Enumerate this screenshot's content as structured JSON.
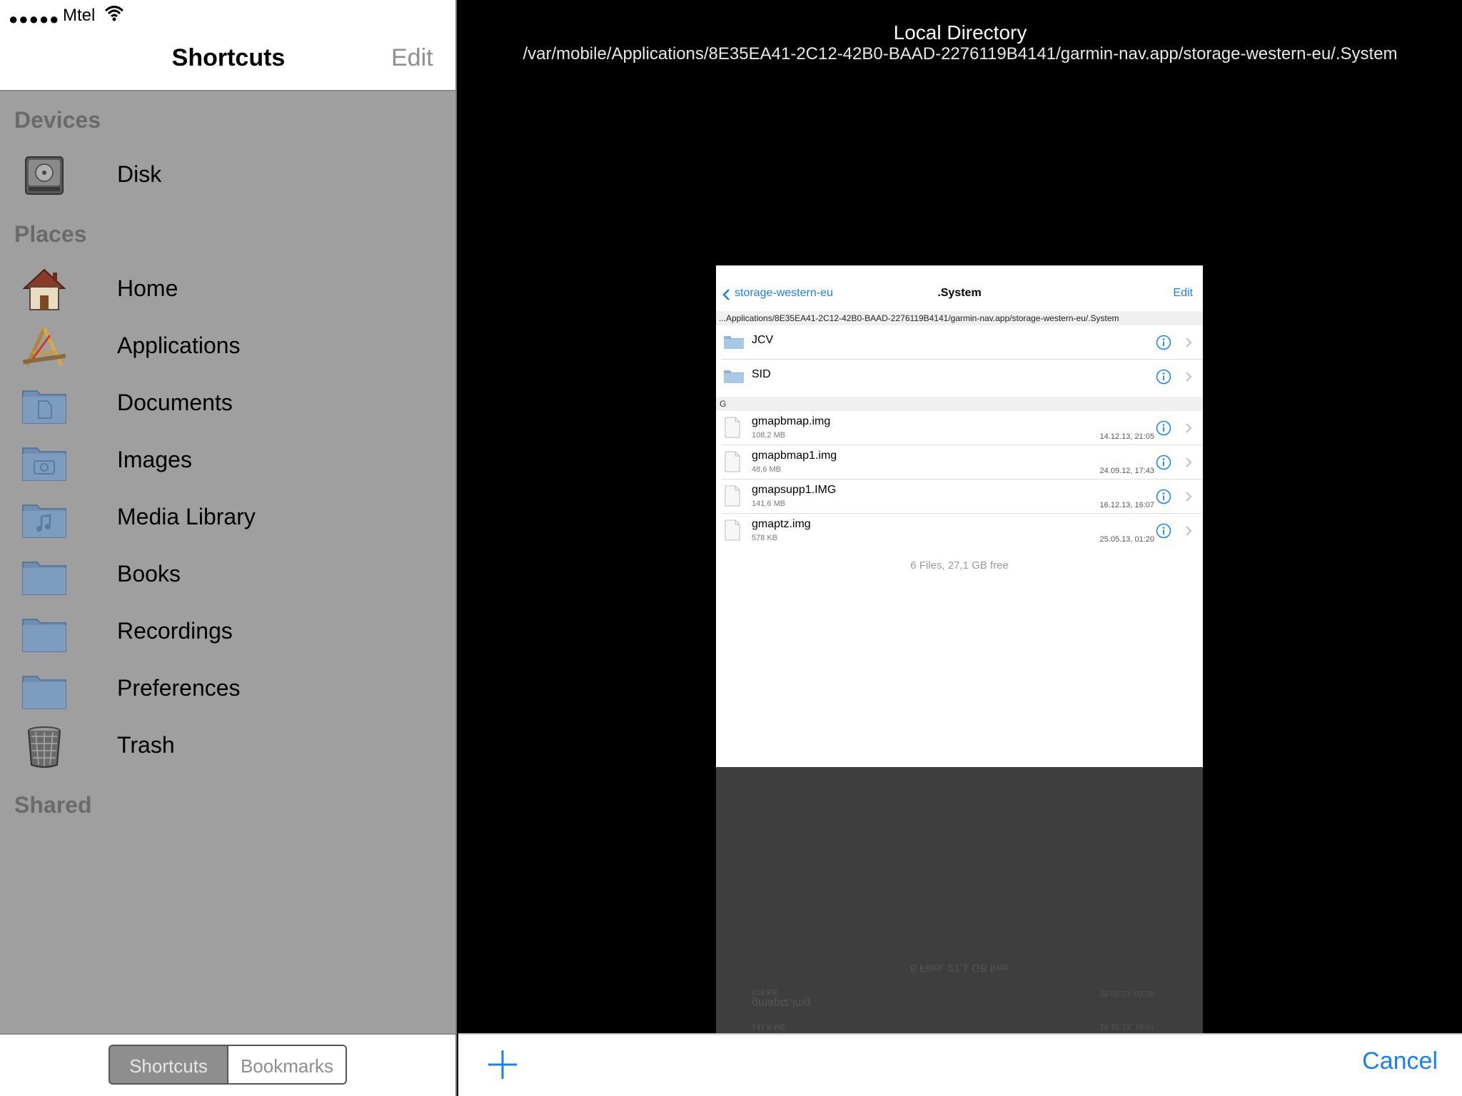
{
  "status_bar": {
    "signal": "●●●●●",
    "carrier": "Mtel"
  },
  "sidebar": {
    "title": "Shortcuts",
    "edit_label": "Edit",
    "sections": {
      "devices": "Devices",
      "places": "Places",
      "shared": "Shared"
    },
    "devices": [
      {
        "label": "Disk",
        "icon": "disk-icon"
      }
    ],
    "places": [
      {
        "label": "Home",
        "icon": "home-icon"
      },
      {
        "label": "Applications",
        "icon": "applications-icon"
      },
      {
        "label": "Documents",
        "icon": "documents-folder-icon"
      },
      {
        "label": "Images",
        "icon": "images-folder-icon"
      },
      {
        "label": "Media Library",
        "icon": "media-folder-icon"
      },
      {
        "label": "Books",
        "icon": "folder-icon"
      },
      {
        "label": "Recordings",
        "icon": "folder-icon"
      },
      {
        "label": "Preferences",
        "icon": "folder-icon"
      },
      {
        "label": "Trash",
        "icon": "trash-icon"
      }
    ],
    "footer": {
      "tabs": [
        "Shortcuts",
        "Bookmarks"
      ],
      "selected": "Shortcuts"
    }
  },
  "main": {
    "title": "Local Directory",
    "path": "/var/mobile/Applications/8E35EA41-2C12-42B0-BAAD-2276119B4141/garmin-nav.app/storage-western-eu/.System",
    "cancel_label": "Cancel",
    "preview": {
      "back_label": "storage-western-eu",
      "title": ".System",
      "edit_label": "Edit",
      "path": "...Applications/8E35EA41-2C12-42B0-BAAD-2276119B4141/garmin-nav.app/storage-western-eu/.System",
      "folders": [
        {
          "name": "JCV"
        },
        {
          "name": "SID"
        }
      ],
      "section_letter": "G",
      "files": [
        {
          "name": "gmapbmap.img",
          "size": "108,2 MB",
          "date": "14.12.13, 21:05"
        },
        {
          "name": "gmapbmap1.img",
          "size": "48,6 MB",
          "date": "24.09.12, 17:43"
        },
        {
          "name": "gmapsupp1.IMG",
          "size": "141,6 MB",
          "date": "16.12.13, 16:07"
        },
        {
          "name": "gmaptz.img",
          "size": "578 KB",
          "date": "25.05.13, 01:20"
        }
      ],
      "summary": "6 Files, 27,1 GB free"
    }
  },
  "colors": {
    "accent": "#1a7ef5",
    "sidebar_bg": "#9f9f9f",
    "reflection_bg": "#3e3e3e"
  }
}
